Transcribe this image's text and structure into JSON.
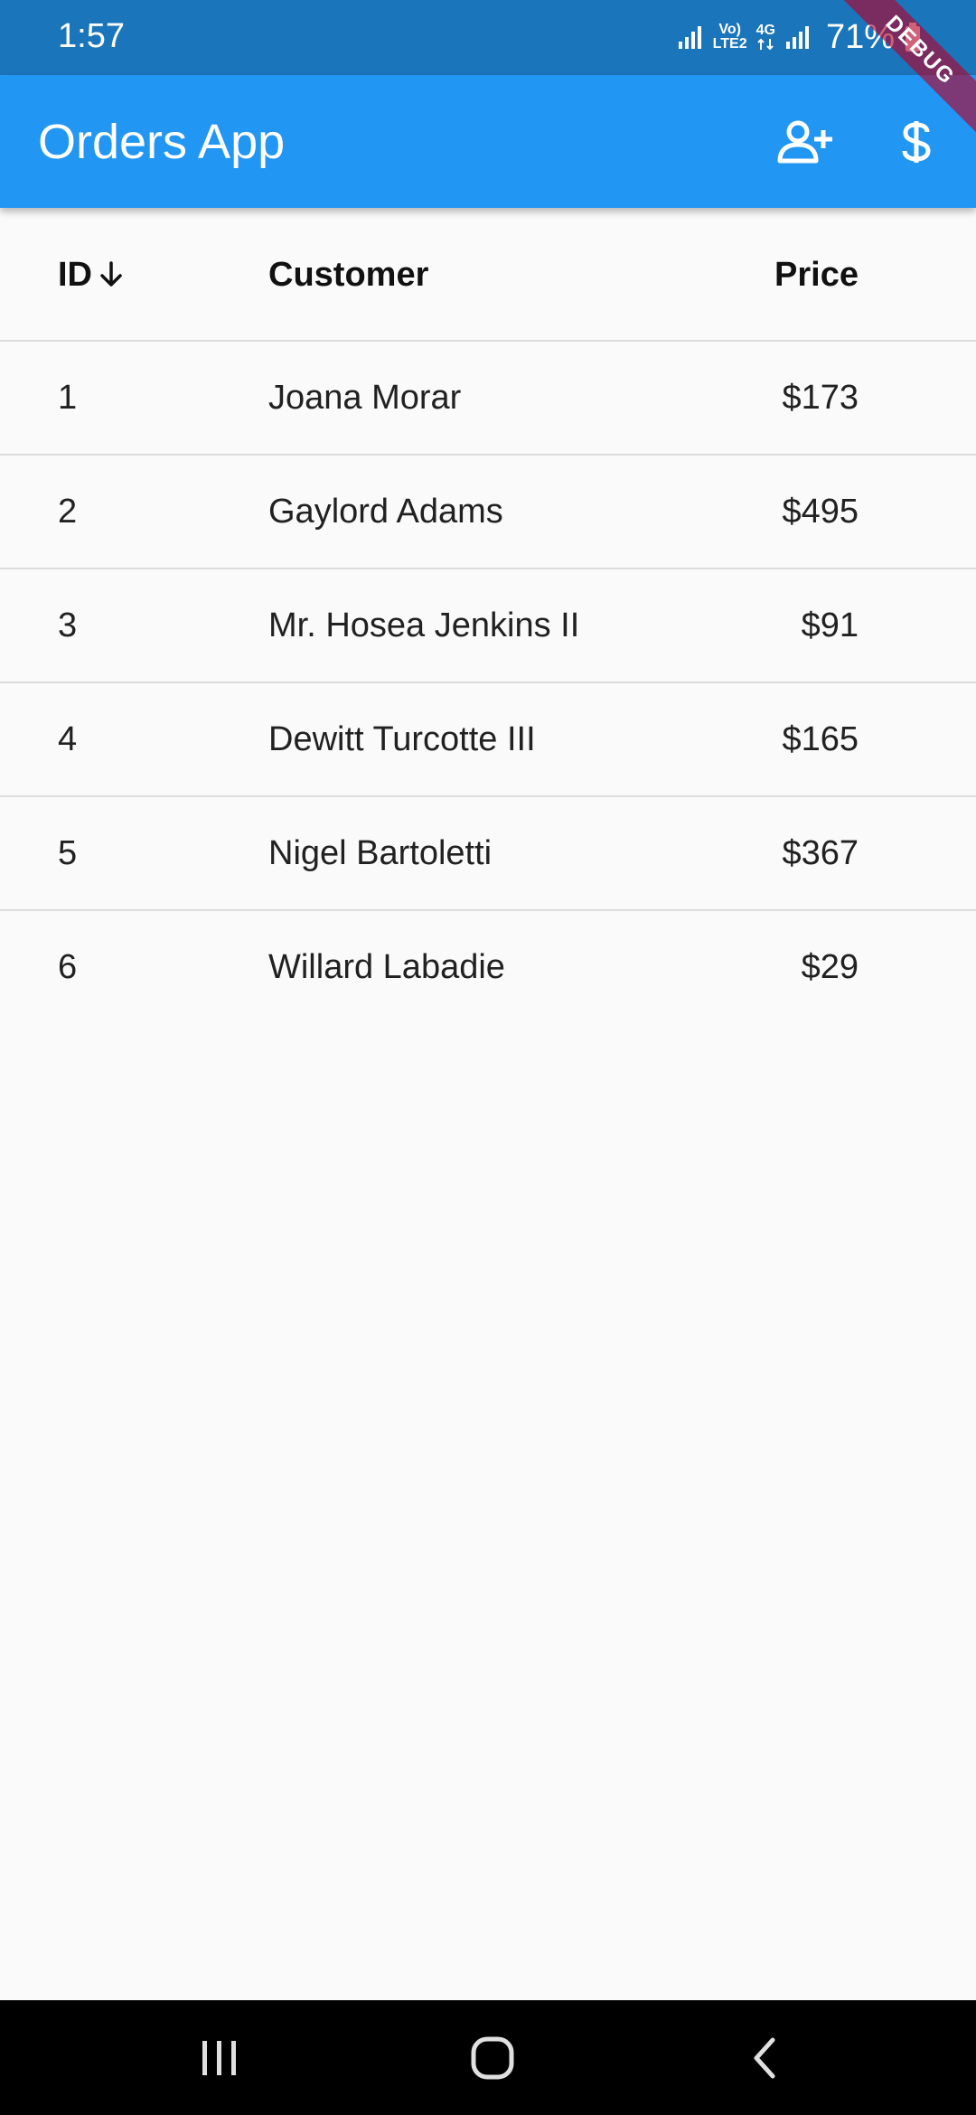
{
  "status_bar": {
    "time": "1:57",
    "tech_top": "Vo)",
    "tech_bottom": "LTE2",
    "network": "4G",
    "battery": "71%"
  },
  "debug_banner": "DEBUG",
  "app_bar": {
    "title": "Orders App",
    "actions": [
      {
        "icon": "add-user-icon"
      },
      {
        "icon": "dollar-icon"
      }
    ],
    "color": "#2196f3"
  },
  "table": {
    "headers": {
      "id": "ID",
      "customer": "Customer",
      "price": "Price"
    },
    "sort": {
      "column": "id",
      "direction": "descending",
      "icon": "arrow-down-icon"
    },
    "rows": [
      {
        "id": "1",
        "customer": "Joana Morar",
        "price": "$173"
      },
      {
        "id": "2",
        "customer": "Gaylord Adams",
        "price": "$495"
      },
      {
        "id": "3",
        "customer": "Mr. Hosea Jenkins II",
        "price": "$91"
      },
      {
        "id": "4",
        "customer": "Dewitt Turcotte III",
        "price": "$165"
      },
      {
        "id": "5",
        "customer": "Nigel Bartoletti",
        "price": "$367"
      },
      {
        "id": "6",
        "customer": "Willard Labadie",
        "price": "$29"
      }
    ]
  },
  "nav_bar": {
    "buttons": [
      {
        "icon": "recents-icon"
      },
      {
        "icon": "home-icon"
      },
      {
        "icon": "back-icon"
      }
    ]
  }
}
